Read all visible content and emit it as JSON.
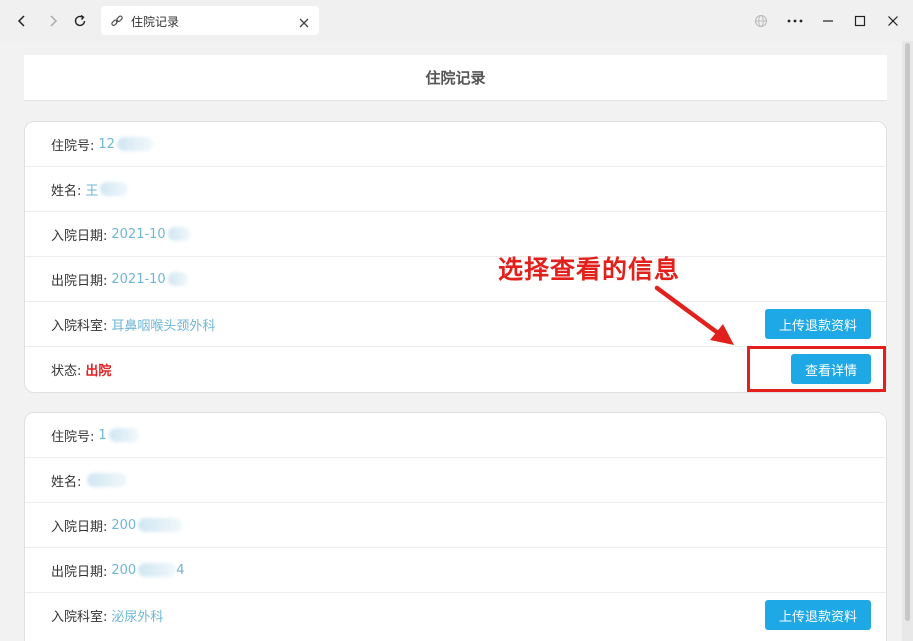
{
  "browser": {
    "tab_title": "住院记录",
    "icons": [
      "back-icon",
      "forward-icon",
      "refresh-icon",
      "link-icon",
      "close-icon",
      "globe-icon",
      "more-icon",
      "minimize-icon",
      "maximize-icon",
      "window-close-icon"
    ]
  },
  "page": {
    "title": "住院记录"
  },
  "labels": {
    "admission_no": "住院号:",
    "name": "姓名:",
    "admit_date": "入院日期:",
    "discharge_date": "出院日期:",
    "department": "入院科室:",
    "status": "状态:"
  },
  "records": [
    {
      "admission_no": "12",
      "name": "王",
      "admit_date": "2021-10",
      "discharge_date": "2021-10",
      "department": "耳鼻咽喉头颈外科",
      "status": "出院",
      "upload_button": "上传退款资料",
      "detail_button": "查看详情"
    },
    {
      "admission_no": "1",
      "name": "",
      "admit_date": "200",
      "discharge_date": "200",
      "discharge_date_tail": "4",
      "department": "泌尿外科",
      "upload_button": "上传退款资料"
    }
  ],
  "annotation": {
    "text": "选择查看的信息"
  },
  "colors": {
    "accent_button": "#1ea8e6",
    "value_text": "#6fb6d6",
    "status_red": "#e02020",
    "annotation_red": "#e3211c"
  }
}
